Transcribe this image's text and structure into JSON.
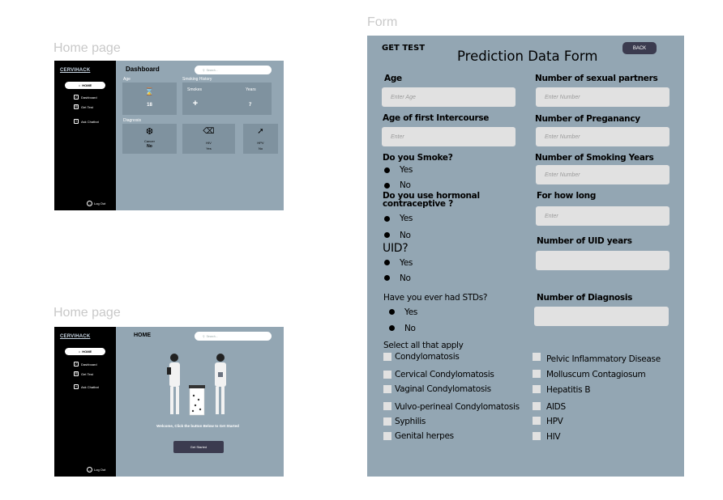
{
  "labels": {
    "home_page_1": "Home page",
    "home_page_2": "Home page",
    "form": "Form"
  },
  "dashboard": {
    "logo": "CERVIHACK",
    "home_btn": "HOME",
    "nav": [
      "Dashboard",
      "Get Test",
      "Ask Chatbot"
    ],
    "logout": "Log Out",
    "title": "Dashboard",
    "search_placeholder": "Search...",
    "age_label": "Age",
    "age_value": "18",
    "smoking_label": "Smoking History",
    "smokes_label": "Smokes",
    "years_label": "Years",
    "years_value": "7",
    "diagnosis_label": "Diagnosis",
    "cancer_label": "Cancer",
    "cancer_value": "No",
    "hiv_label": "HIV",
    "hiv_value": "Yes",
    "hpv_label": "HPV",
    "hpv_value": "No"
  },
  "home": {
    "logo": "CERVIHACK",
    "home_btn": "HOME",
    "nav": [
      "Dashboard",
      "Get Test",
      "Ask Chatbot"
    ],
    "logout": "Log Out",
    "title": "HOME",
    "search_placeholder": "Search...",
    "welcome": "Welcome, Click the button Below to Get Started",
    "cta": "Get Started"
  },
  "form": {
    "get_test": "GET TEST",
    "title": "Prediction Data  Form",
    "back": "BACK",
    "age": "Age",
    "age_placeholder": "Enter Age",
    "partners": "Number of sexual partners",
    "partners_placeholder": "Enter Number",
    "first_intercourse": "Age of first Intercourse",
    "first_intercourse_placeholder": "Enter",
    "pregnancy": "Number of Preganancy",
    "pregnancy_placeholder": "Enter Number",
    "smoke_q": "Do you Smoke?",
    "yes": "Yes",
    "no": "No",
    "smoking_years": "Number of Smoking Years",
    "smoking_years_placeholder": "Enter Number",
    "hormonal_q1": "Do you use hormonal",
    "hormonal_q2": "contraceptive ?",
    "how_long": "For how long",
    "how_long_placeholder": "Enter",
    "uid_q": "UID?",
    "uid_years": "Number of UID years",
    "std_q": "Have you ever had STDs?",
    "num_diagnosis": "Number of Diagnosis",
    "select_all": "Select all that apply",
    "left_options": [
      "Condylomatosis",
      "Cervical Condylomatosis",
      "Vaginal Condylomatosis",
      "Vulvo-perineal Condylomatosis",
      "Syphilis",
      "Genital herpes"
    ],
    "right_options": [
      "Pelvic  Inflammatory Disease",
      "Molluscum Contagiosum",
      "Hepatitis B",
      "AIDS",
      "HPV",
      "HIV"
    ]
  }
}
